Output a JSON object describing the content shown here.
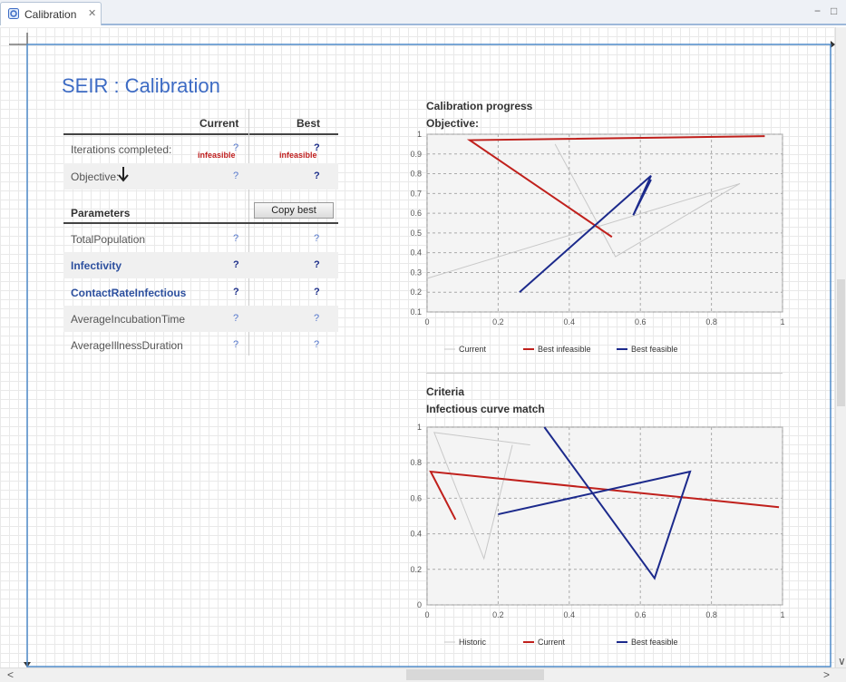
{
  "tab": {
    "label": "Calibration"
  },
  "page": {
    "title": "SEIR : Calibration"
  },
  "table": {
    "col_current": "Current",
    "col_best": "Best",
    "iterations_label": "Iterations completed:",
    "iterations_current": "?",
    "iterations_best": "?",
    "infeasible_current": "infeasible",
    "infeasible_best": "infeasible",
    "objective_label": "Objective:",
    "objective_current": "?",
    "objective_best": "?",
    "parameters_label": "Parameters",
    "copy_best": "Copy best",
    "params": [
      {
        "name": "TotalPopulation",
        "current": "?",
        "best": "?",
        "bold": false
      },
      {
        "name": "Infectivity",
        "current": "?",
        "best": "?",
        "bold": true
      },
      {
        "name": "ContactRateInfectious",
        "current": "?",
        "best": "?",
        "bold": true
      },
      {
        "name": "AverageIncubationTime",
        "current": "?",
        "best": "?",
        "bold": false
      },
      {
        "name": "AverageIllnessDuration",
        "current": "?",
        "best": "?",
        "bold": false
      }
    ]
  },
  "chart1": {
    "section": "Calibration progress",
    "subtitle": "Objective:"
  },
  "chart2": {
    "section": "Criteria",
    "subtitle": "Infectious curve match"
  },
  "colors": {
    "light": "#c8c8c8",
    "red": "#c0201c",
    "blue": "#1c2a8c",
    "accent": "#3d6bc4"
  },
  "chart_data": [
    {
      "type": "line",
      "xlim": [
        0,
        1
      ],
      "ylim": [
        0.1,
        1
      ],
      "x_ticks": [
        "0",
        "0.2",
        "0.4",
        "0.6",
        "0.8",
        "1"
      ],
      "y_ticks": [
        "0.1",
        "0.2",
        "0.3",
        "0.4",
        "0.5",
        "0.6",
        "0.7",
        "0.8",
        "0.9",
        "1"
      ],
      "grid": true,
      "legend_position": "bottom",
      "series": [
        {
          "name": "Current",
          "color": "#c8c8c8",
          "width": 1,
          "points": [
            [
              0,
              0.27
            ],
            [
              0.88,
              0.75
            ],
            [
              0.53,
              0.38
            ],
            [
              0.36,
              0.95
            ]
          ]
        },
        {
          "name": "Best infeasible",
          "color": "#c0201c",
          "width": 2,
          "points": [
            [
              0.52,
              0.48
            ],
            [
              0.12,
              0.97
            ],
            [
              0.95,
              0.99
            ]
          ]
        },
        {
          "name": "Best feasible",
          "color": "#1c2a8c",
          "width": 2,
          "points": [
            [
              0.26,
              0.2
            ],
            [
              0.63,
              0.79
            ],
            [
              0.58,
              0.59
            ],
            [
              0.63,
              0.77
            ]
          ]
        }
      ]
    },
    {
      "type": "line",
      "xlim": [
        0,
        1
      ],
      "ylim": [
        0,
        1
      ],
      "x_ticks": [
        "0",
        "0.2",
        "0.4",
        "0.6",
        "0.8",
        "1"
      ],
      "y_ticks": [
        "0",
        "0.2",
        "0.4",
        "0.6",
        "0.8",
        "1"
      ],
      "grid": true,
      "legend_position": "bottom",
      "series": [
        {
          "name": "Historic",
          "color": "#c8c8c8",
          "width": 1,
          "points": [
            [
              0.29,
              0.9
            ],
            [
              0.02,
              0.97
            ],
            [
              0.16,
              0.26
            ],
            [
              0.24,
              0.9
            ]
          ]
        },
        {
          "name": "Current",
          "color": "#c0201c",
          "width": 2,
          "points": [
            [
              0.08,
              0.48
            ],
            [
              0.01,
              0.75
            ],
            [
              0.99,
              0.55
            ]
          ]
        },
        {
          "name": "Best feasible",
          "color": "#1c2a8c",
          "width": 2,
          "points": [
            [
              0.2,
              0.51
            ],
            [
              0.74,
              0.75
            ],
            [
              0.64,
              0.15
            ],
            [
              0.33,
              1.0
            ]
          ]
        }
      ]
    }
  ]
}
